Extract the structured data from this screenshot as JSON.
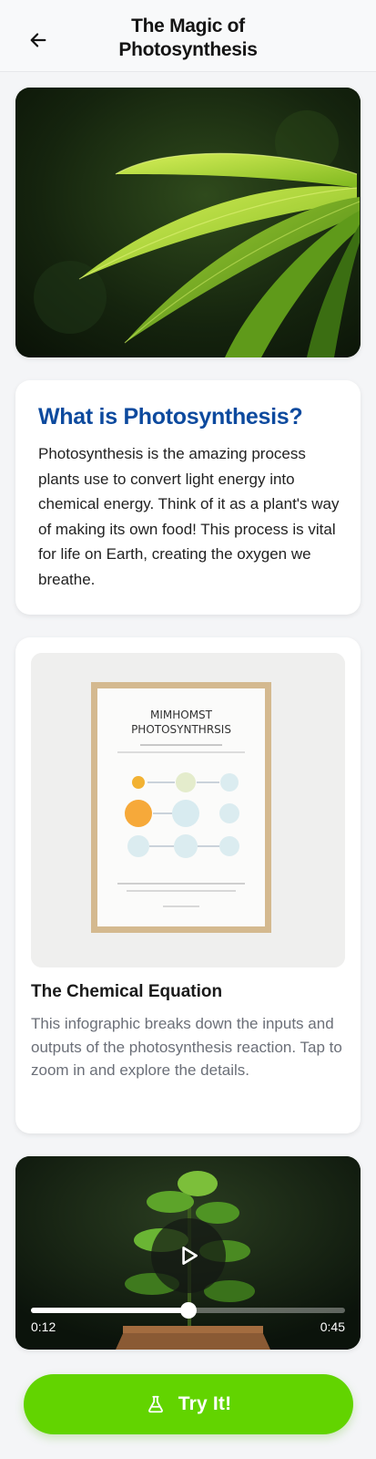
{
  "header": {
    "title": "The Magic of Photosynthesis",
    "back_icon": "arrow-left-icon"
  },
  "hero": {
    "image": "sunlit green leaves photo"
  },
  "intro": {
    "title": "What is Photosynthesis?",
    "body": "Photosynthesis is the amazing process plants use to convert light energy into chemical energy. Think of it as a plant's way of making its own food! This process is vital for life on Earth, creating the oxygen we breathe."
  },
  "infographic": {
    "poster_title_line1": "MIMHOMST",
    "poster_title_line2": "PHOTOSYNTHRSIS",
    "title": "The Chemical Equation",
    "body": "This infographic breaks down the inputs and outputs of the photosynthesis reaction. Tap to zoom in and explore the details."
  },
  "video": {
    "current_time": "0:12",
    "total_time": "0:45",
    "progress": 0.5,
    "play_icon": "play-icon"
  },
  "cta": {
    "label": "Try It!",
    "icon": "flask-icon"
  },
  "colors": {
    "accent_green": "#62d400",
    "heading_blue": "#0d4a9e",
    "muted_text": "#6b6f78"
  }
}
